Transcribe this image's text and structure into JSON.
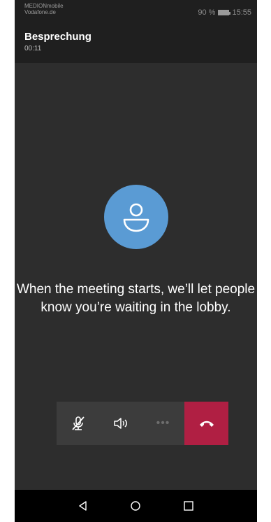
{
  "status_bar": {
    "carrier_line1": "MEDIONmobile",
    "carrier_line2": "Vodafone.de",
    "battery": "90 %",
    "time": "15:55"
  },
  "header": {
    "title": "Besprechung",
    "timer": "00:11"
  },
  "main": {
    "message": "When the meeting starts, we’ll let people know you’re waiting in the lobby.",
    "avatar_icon": "person-icon",
    "avatar_color": "#5a9bd4"
  },
  "call_controls": {
    "buttons": [
      {
        "icon": "mic-muted-icon"
      },
      {
        "icon": "speaker-icon"
      },
      {
        "icon": "more-options-icon",
        "label": "•••"
      },
      {
        "icon": "hang-up-icon",
        "color": "#b01f43"
      }
    ]
  },
  "nav_bar": {
    "buttons": [
      "back-icon",
      "home-icon",
      "recents-icon"
    ]
  }
}
